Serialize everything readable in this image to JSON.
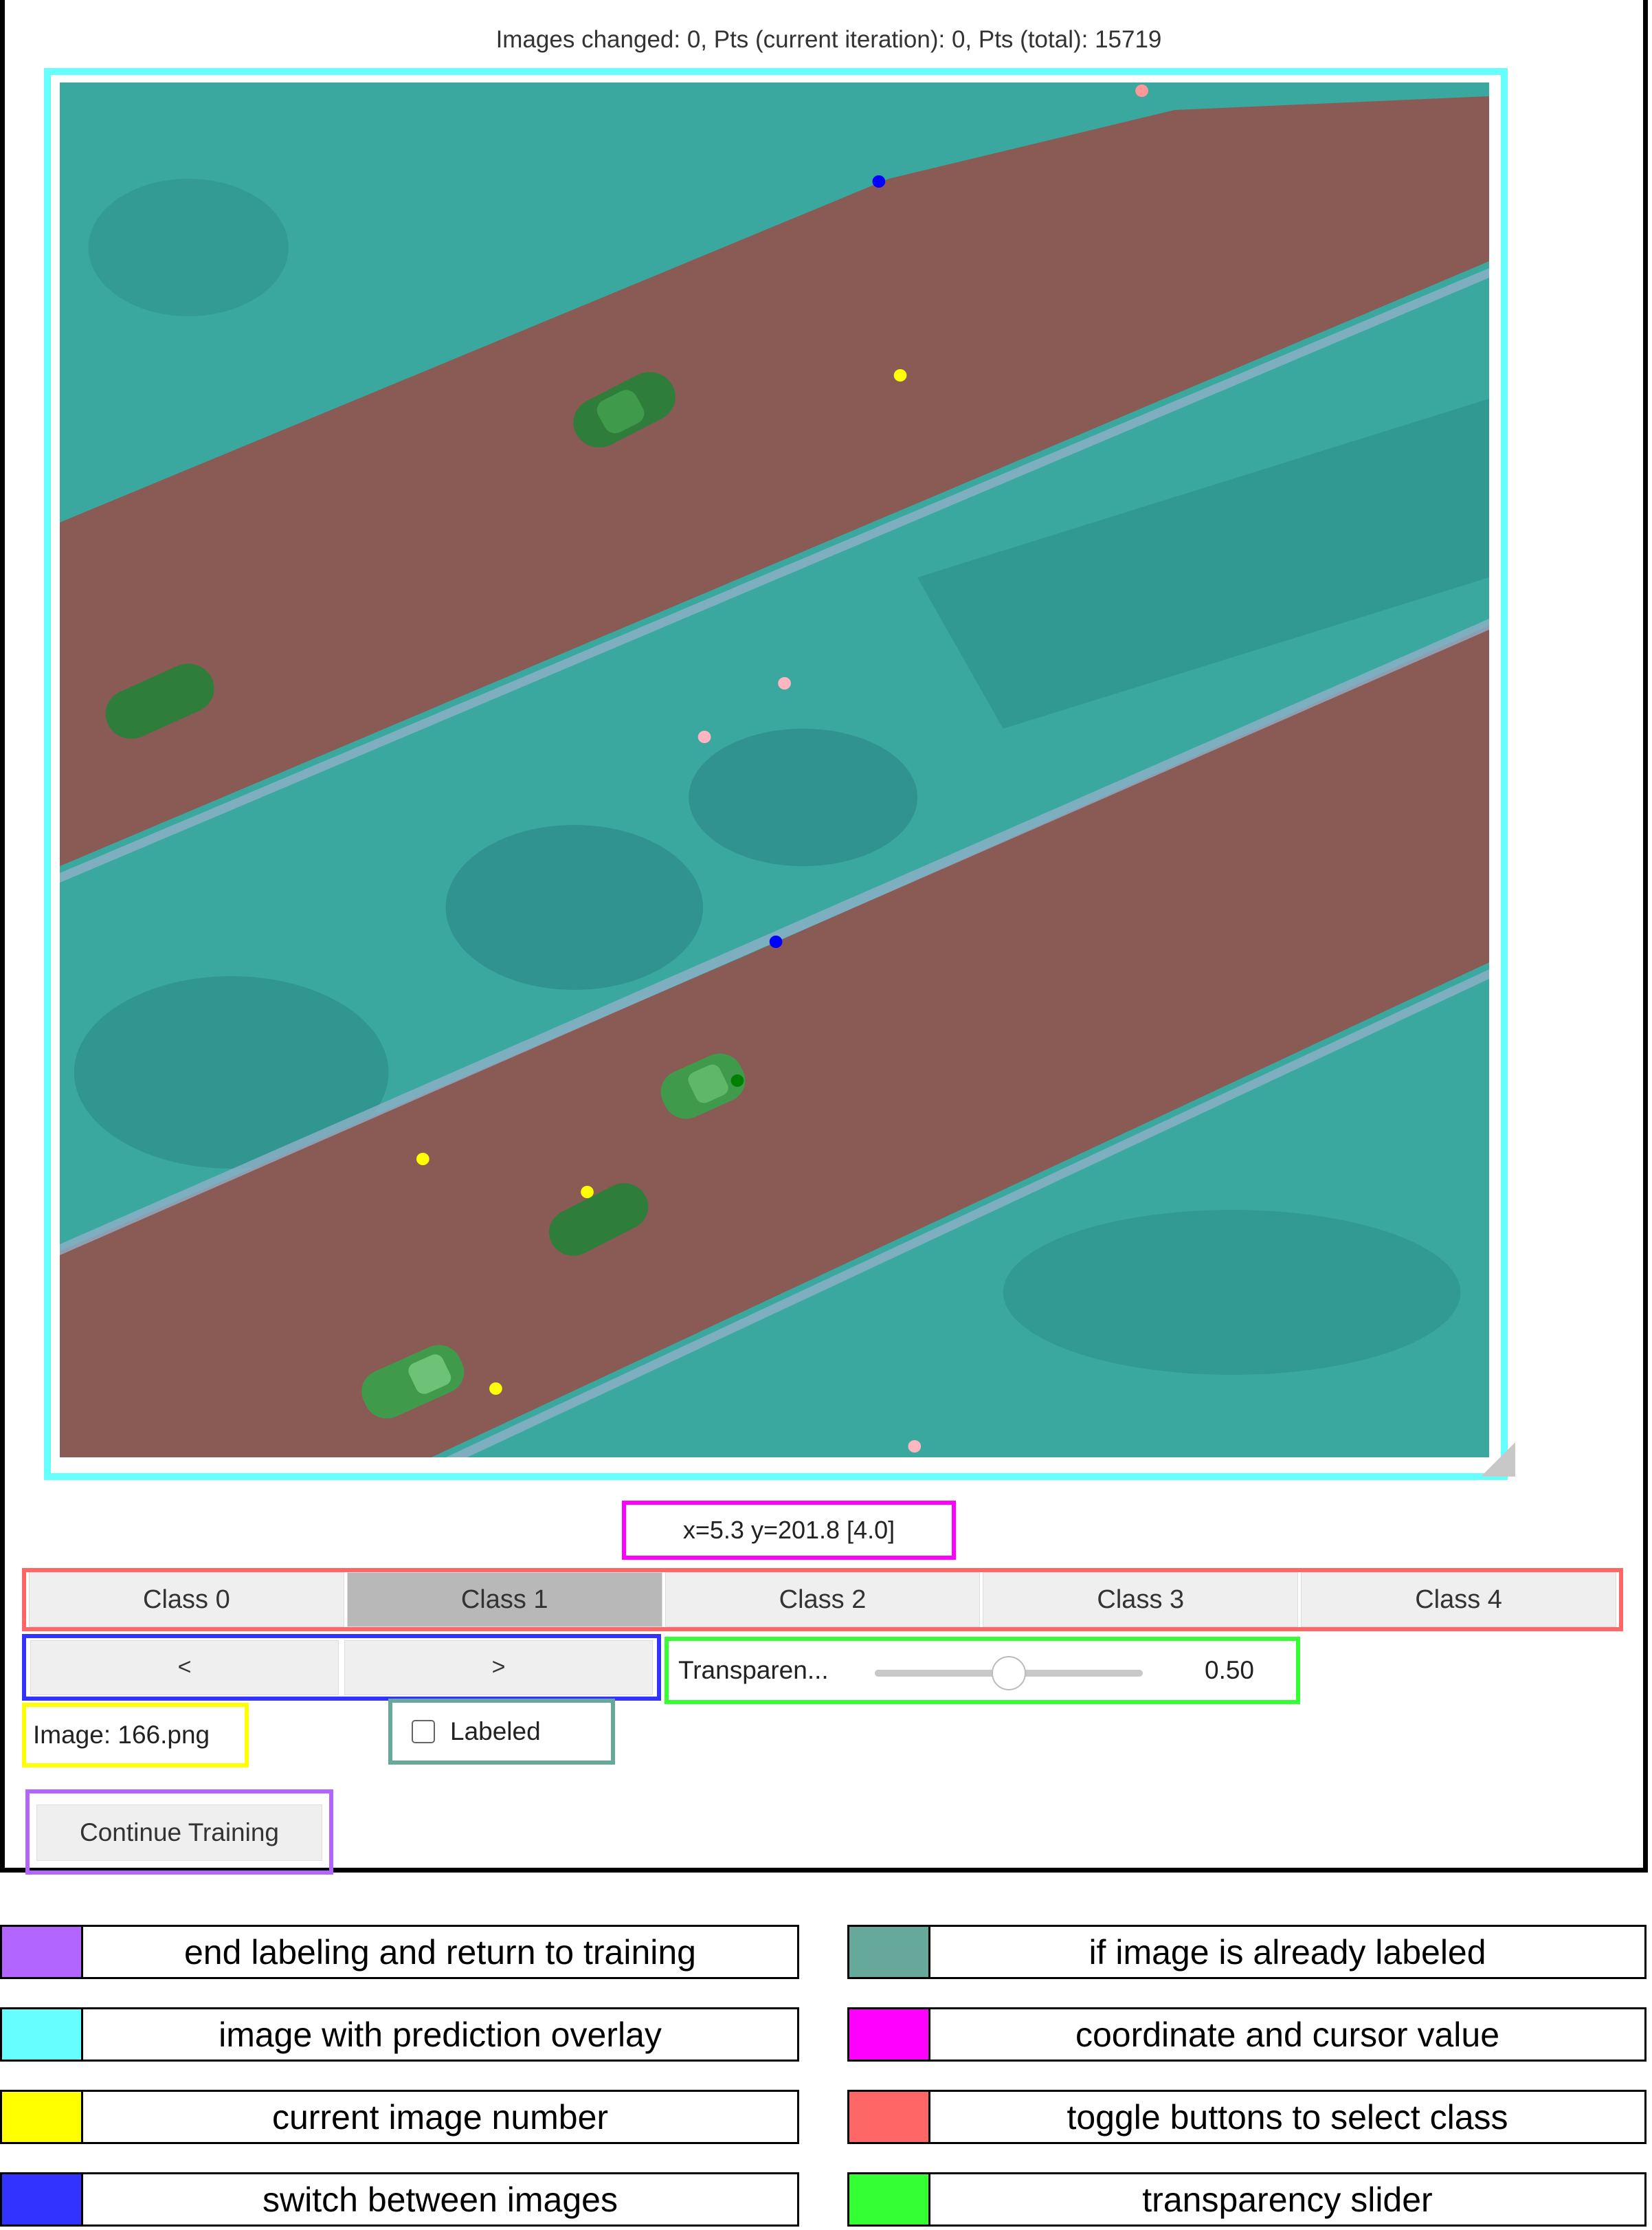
{
  "status": {
    "text": "Images changed: 0, Pts (current iteration): 0, Pts (total): 15719"
  },
  "viewport": {
    "image_description": "aerial-road-prediction-overlay",
    "overlay_colors": {
      "road": "#8a5a55",
      "vegetation": "#3aa89e",
      "car": "#2e7d3a"
    },
    "points": [
      {
        "color": "#ff9999"
      },
      {
        "color": "#0000ff"
      },
      {
        "color": "#ffff00"
      },
      {
        "color": "#ffb6c1"
      },
      {
        "color": "#ffb6c1"
      },
      {
        "color": "#0000ff"
      },
      {
        "color": "#ffff00"
      },
      {
        "color": "#ffff00"
      },
      {
        "color": "#ffff00"
      },
      {
        "color": "#008000"
      },
      {
        "color": "#ffb6c1"
      }
    ]
  },
  "coordinate": {
    "text": "x=5.3 y=201.8 [4.0]"
  },
  "classes": {
    "buttons": [
      {
        "label": "Class 0",
        "active": false
      },
      {
        "label": "Class 1",
        "active": true
      },
      {
        "label": "Class 2",
        "active": false
      },
      {
        "label": "Class 3",
        "active": false
      },
      {
        "label": "Class 4",
        "active": false
      }
    ]
  },
  "navigation": {
    "prev_label": "<",
    "next_label": ">"
  },
  "transparency": {
    "label": "Transparen...",
    "value": 0.5,
    "value_text": "0.50"
  },
  "image_info": {
    "text": "Image: 166.png"
  },
  "labeled": {
    "label": "Labeled",
    "checked": false
  },
  "continue": {
    "label": "Continue Training"
  },
  "legend": {
    "items": [
      {
        "color": "#b366ff",
        "text": "end labeling and return to training"
      },
      {
        "color": "#66a89a",
        "text": "if image is already labeled"
      },
      {
        "color": "#66ffff",
        "text": "image with prediction overlay"
      },
      {
        "color": "#ff00ff",
        "text": "coordinate and cursor value"
      },
      {
        "color": "#ffff00",
        "text": "current image number"
      },
      {
        "color": "#ff6666",
        "text": "toggle buttons to select class"
      },
      {
        "color": "#3333ff",
        "text": "switch between images"
      },
      {
        "color": "#33ff33",
        "text": "transparency slider"
      }
    ]
  }
}
